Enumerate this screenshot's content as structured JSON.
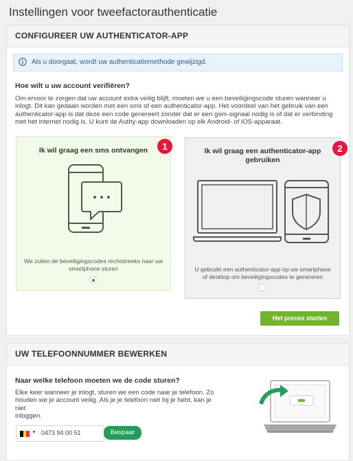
{
  "page": {
    "title": "Instellingen voor tweefactorauthenticatie"
  },
  "configure": {
    "header": "CONFIGUREER UW AUTHENTICATOR-APP",
    "info_text": "Als u doorgaat, wordt uw authenticatiemethode gewijzigd.",
    "question": "Hoe wilt u uw account verifiëren?",
    "intro_lines": [
      "Om ervoor te zorgen dat uw account extra veilig blijft, moeten we u een beveiligingscode sturen wanneer u",
      "inlogt. Dit kan gedaan worden met een sms of een authenticator-app. Het voordeel van het gebruik van een",
      "authenticator-app is dat deze een code genereert zonder dat er een gsm-signaal nodig is of dat er verbinding",
      "met het internet nodig is. U kunt de Authy-app downloaden op elk Android- of iOS-apparaat."
    ],
    "options": [
      {
        "badge": "1",
        "title": "Ik wil graag een sms ontvangen",
        "desc_lines": [
          "We zullen de beveiligingscodes rechtstreeks naar uw",
          "smartphone sturen"
        ],
        "selected": true
      },
      {
        "badge": "2",
        "title_lines": [
          "Ik wil graag een authenticator-app",
          "gebruiken"
        ],
        "desc_lines": [
          "U gebruikt een authenticator-app op uw smartphone",
          "of desktop om beveiligingscodes te genereren"
        ],
        "selected": false
      }
    ],
    "start_button": "Het proces starten"
  },
  "phone": {
    "header": "UW TELEFOONNUMMER BEWERKEN",
    "question": "Naar welke telefoon moeten we de code sturen?",
    "intro_lines": [
      "Elke keer wanneer je inlogt, sturen we een code naar je telefoon. Zo",
      "houden we je account veilig. Als je je telefoon niet bij je hebt, kan je niet",
      "inloggen."
    ],
    "number": "0473 94 00 51",
    "country_flag": [
      "#000000",
      "#fdda24",
      "#ef3340"
    ],
    "save_button": "Bespaar"
  },
  "colors": {
    "accent_green": "#72b42a",
    "save_green": "#239d5c",
    "badge_red": "#e8163b",
    "info_blue": "#2f5b87"
  }
}
